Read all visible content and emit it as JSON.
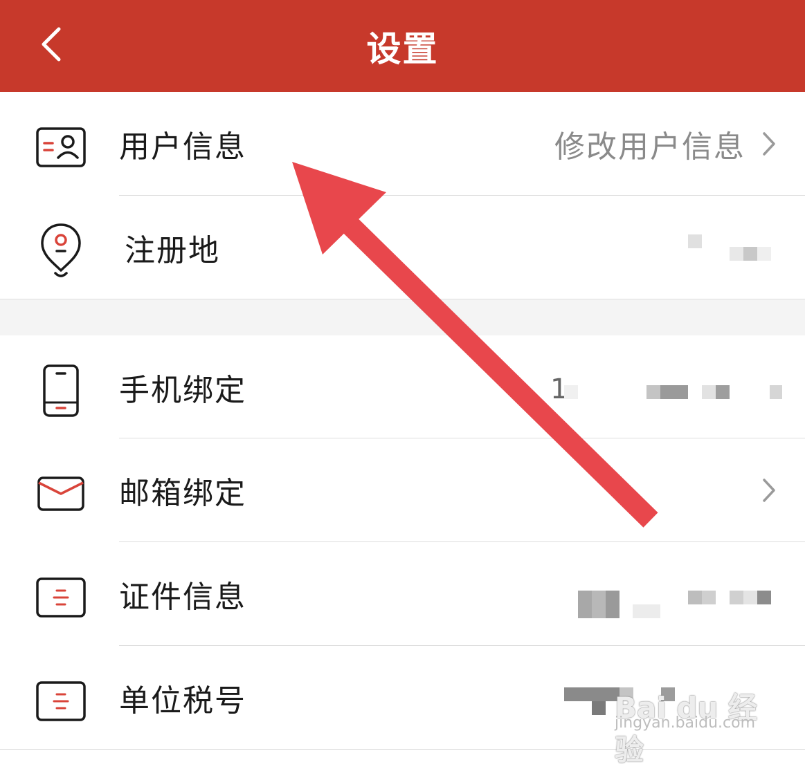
{
  "header": {
    "title": "设置"
  },
  "rows": [
    {
      "label": "用户信息",
      "value": "修改用户信息",
      "icon": "user-card-icon"
    },
    {
      "label": "注册地",
      "value": "",
      "icon": "location-pin-icon"
    },
    {
      "label": "手机绑定",
      "value": "1",
      "icon": "phone-icon"
    },
    {
      "label": "邮箱绑定",
      "value": "",
      "icon": "envelope-icon"
    },
    {
      "label": "证件信息",
      "value": "",
      "icon": "id-document-icon"
    },
    {
      "label": "单位税号",
      "value": "",
      "icon": "tax-document-icon"
    }
  ],
  "watermark": {
    "brand": "Bai du 经验",
    "url": "jingyan.baidu.com"
  },
  "colors": {
    "header_bg": "#C7392B",
    "accent": "#D9443A",
    "annotation_arrow": "#E8474C"
  }
}
